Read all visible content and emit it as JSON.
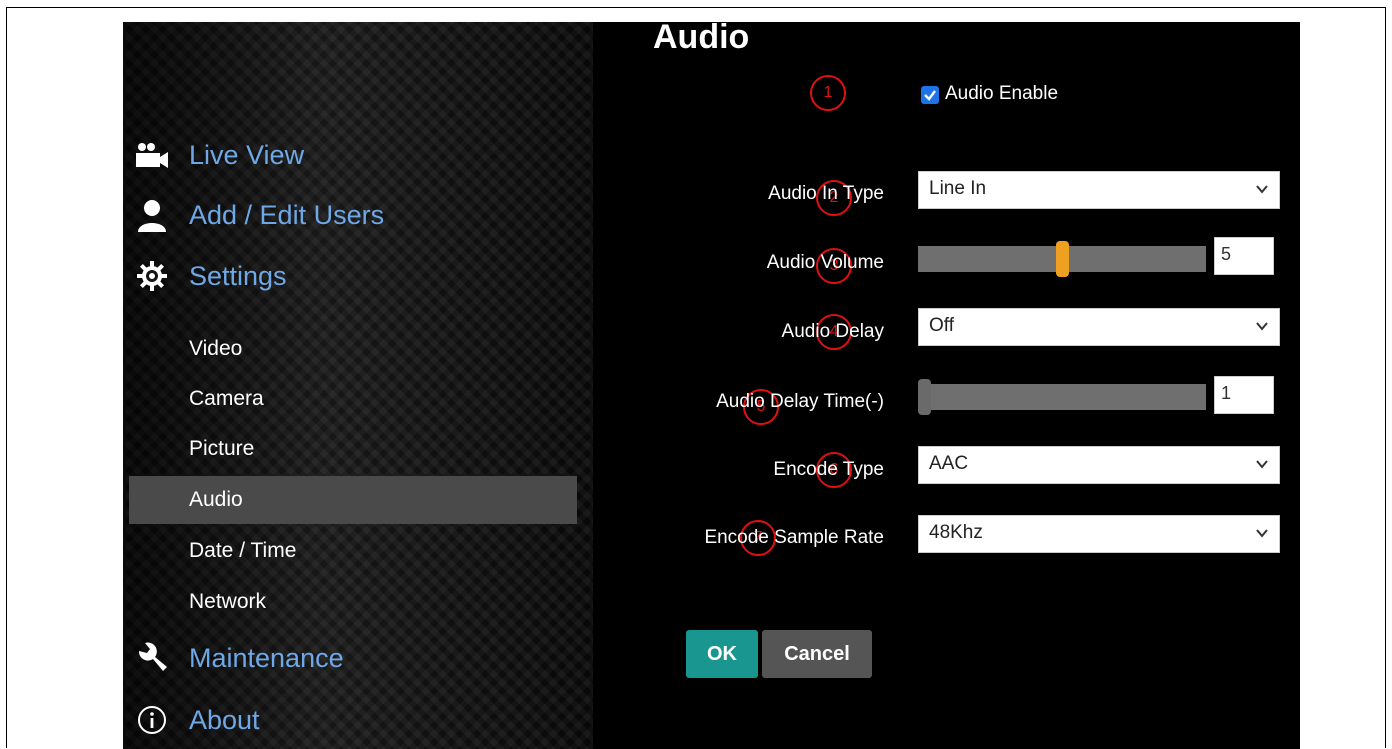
{
  "sidebar": {
    "main_items": [
      {
        "label": "Live View",
        "icon": "video-camera-icon"
      },
      {
        "label": "Add / Edit Users",
        "icon": "user-icon"
      },
      {
        "label": "Settings",
        "icon": "gear-icon"
      },
      {
        "label": "Maintenance",
        "icon": "wrench-icon"
      },
      {
        "label": "About",
        "icon": "info-icon"
      }
    ],
    "sub_items": [
      "Video",
      "Camera",
      "Picture",
      "Audio",
      "Date / Time",
      "Network"
    ],
    "active_sub": "Audio",
    "link_color": "#6fa8e6"
  },
  "main": {
    "title": "Audio",
    "markers": [
      "1",
      "2",
      "3",
      "4",
      "5",
      "6",
      "7"
    ],
    "audio_enable": {
      "label": "Audio Enable",
      "checked": true
    },
    "audio_in_type": {
      "label": "Audio In Type",
      "value": "Line In"
    },
    "audio_volume": {
      "label": "Audio Volume",
      "value": "5",
      "level": 0.5
    },
    "audio_delay": {
      "label": "Audio Delay",
      "value": "Off"
    },
    "audio_delay_time": {
      "label": "Audio Delay Time(-)",
      "value": "1",
      "level": 0.0
    },
    "encode_type": {
      "label": "Encode Type",
      "value": "AAC"
    },
    "encode_sample_rate": {
      "label": "Encode Sample Rate",
      "value": "48Khz"
    },
    "ok_label": "OK",
    "cancel_label": "Cancel"
  },
  "colors": {
    "ok_button": "#18968f",
    "cancel_button": "#555555",
    "marker_red": "#e01010",
    "volume_thumb": "#f0a020",
    "delay_thumb": "#6a6a6a",
    "checkbox_blue": "#1e73e8"
  }
}
